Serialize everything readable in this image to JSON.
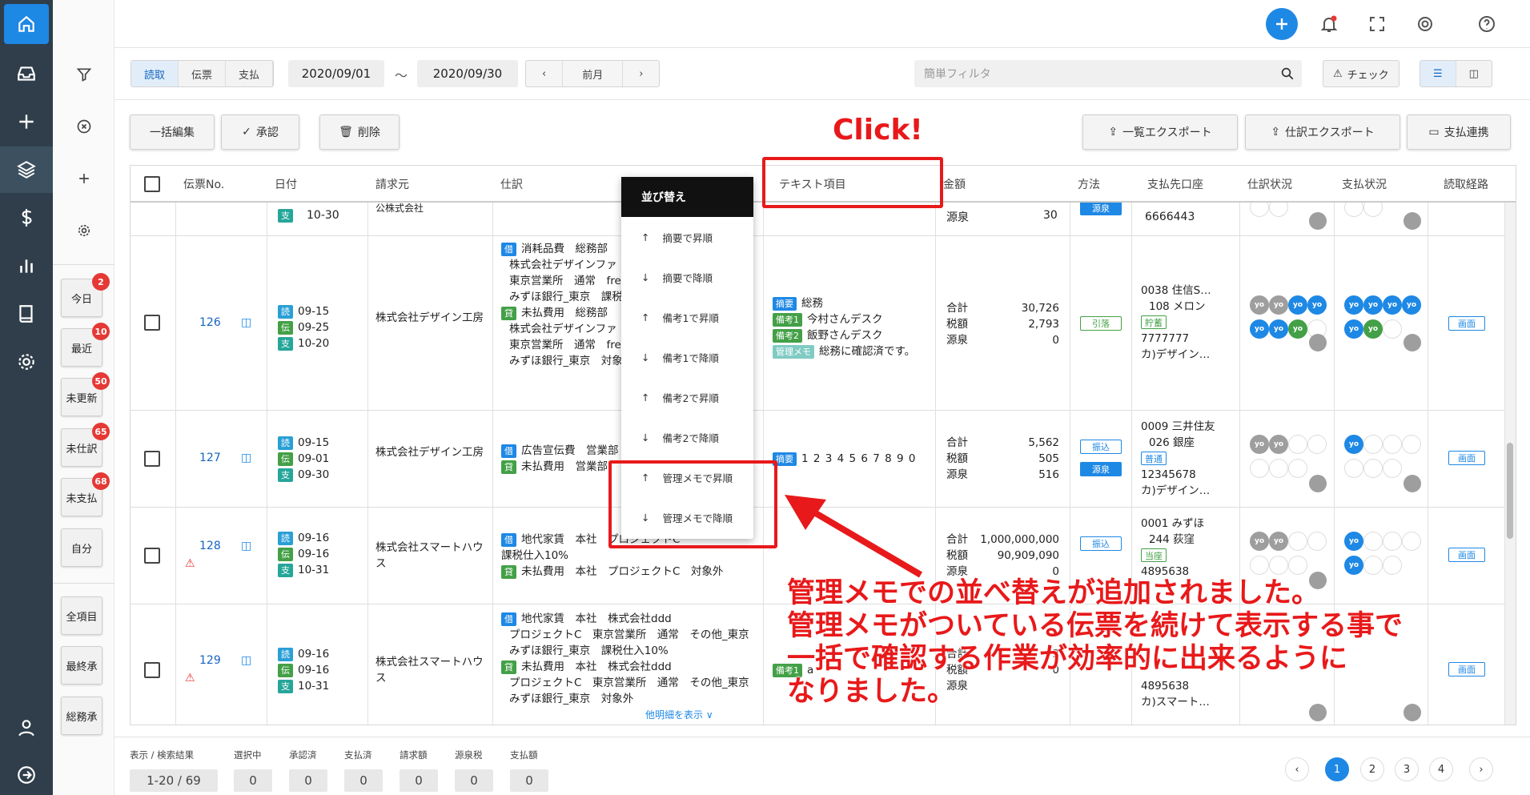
{
  "quick_filters": [
    {
      "label": "今日",
      "count": "2"
    },
    {
      "label": "最近",
      "count": "10"
    },
    {
      "label": "未更新",
      "count": "50"
    },
    {
      "label": "未仕訳",
      "count": "65"
    },
    {
      "label": "未支払",
      "count": "68"
    },
    {
      "label": "自分",
      "count": ""
    },
    {
      "label": "全項目",
      "count": ""
    },
    {
      "label": "最終承",
      "count": ""
    },
    {
      "label": "総務承",
      "count": ""
    }
  ],
  "toolbar": {
    "tabs": [
      "読取",
      "伝票",
      "支払"
    ],
    "date_from": "2020/09/01",
    "tilde": "～",
    "date_to": "2020/09/30",
    "prev_month": "前月",
    "search_placeholder": "簡単フィルタ",
    "check_label": "チェック"
  },
  "actions": {
    "bulk_edit": "一括編集",
    "approve": "承認",
    "delete": "削除",
    "list_export": "一覧エクスポート",
    "journal_export": "仕訳エクスポート",
    "payment_link": "支払連携"
  },
  "columns": [
    "伝票No.",
    "日付",
    "請求元",
    "仕訳",
    "テキスト項目",
    "金額",
    "方法",
    "支払先口座",
    "仕訳状況",
    "支払状況",
    "読取経路"
  ],
  "rows": [
    {
      "no": "",
      "date_tags": [
        "支"
      ],
      "dates": [
        "10-30"
      ],
      "vendor": "公株式会社",
      "journal": [],
      "text": [],
      "amount": {
        "lbl": [
          "源泉"
        ],
        "val": [
          "30"
        ]
      },
      "method": [
        "源泉"
      ],
      "bank": [
        "6666443"
      ]
    },
    {
      "no": "126",
      "dates": [
        "09-15",
        "09-25",
        "10-20"
      ],
      "vendor": "株式会社デザイン工房",
      "journal": [
        "消耗品費　総務部",
        "株式会社デザインファ",
        "東京営業所　通常　free",
        "みずほ銀行_東京　課税",
        "未払費用　総務部",
        "株式会社デザインファ",
        "東京営業所　通常　free",
        "みずほ銀行_東京　対象外"
      ],
      "text_tags": [
        "摘要",
        "備考1",
        "備考2",
        "管理メモ"
      ],
      "text": [
        "総務",
        "今村さんデスク",
        "飯野さんデスク",
        "総務に確認済です。"
      ],
      "amount_lbl": [
        "合計",
        "税額",
        "源泉"
      ],
      "amount_val": [
        "30,726",
        "2,793",
        "0"
      ],
      "method": "引落",
      "bank": [
        "0038 住信S…",
        "108 メロン",
        "貯蓄",
        "7777777",
        "カ)デザイン…"
      ],
      "route": "画面"
    },
    {
      "no": "127",
      "dates": [
        "09-15",
        "09-01",
        "09-30"
      ],
      "vendor": "株式会社デザイン工房",
      "journal": [
        "広告宣伝費　営業部",
        "未払費用　営業部"
      ],
      "text_tag": "摘要",
      "text": "1 2 3 4 5 6 7 8 9 0",
      "amount_lbl": [
        "合計",
        "税額",
        "源泉"
      ],
      "amount_val": [
        "5,562",
        "505",
        "516"
      ],
      "method": [
        "振込",
        "源泉"
      ],
      "bank": [
        "0009 三井住友",
        "026 銀座",
        "普通",
        "12345678",
        "カ)デザイン…"
      ],
      "route": "画面"
    },
    {
      "no": "128",
      "dates": [
        "09-16",
        "09-16",
        "10-31"
      ],
      "vendor": "株式会社スマートハウス",
      "journal": [
        "地代家賃　本社　プロジェクトC",
        "課税仕入10%",
        "未払費用　本社　プロジェクトC　対象外"
      ],
      "amount_lbl": [
        "合計",
        "税額",
        "源泉"
      ],
      "amount_val": [
        "1,000,000,000",
        "90,909,090",
        "0"
      ],
      "method": "振込",
      "bank": [
        "0001 みずほ",
        "244 荻窪",
        "当座",
        "4895638"
      ],
      "route": "画面"
    },
    {
      "no": "129",
      "dates": [
        "09-16",
        "09-16",
        "10-31"
      ],
      "vendor": "株式会社スマートハウス",
      "journal": [
        "地代家賃　本社　株式会社ddd",
        "プロジェクトC　東京営業所　通常　その他_東京",
        "みずほ銀行_東京　課税仕入10%",
        "未払費用　本社　株式会社ddd",
        "プロジェクトC　東京営業所　通常　その他_東京",
        "みずほ銀行_東京　対象外"
      ],
      "more": "他明細を表示 ∨",
      "text_tag": "備考1",
      "text": "a",
      "amount_lbl": [
        "合計",
        "税額",
        "源泉"
      ],
      "amount_val": [
        "3",
        "",
        "0"
      ],
      "bank": [
        "4895638",
        "カ)スマート…"
      ],
      "route": "画面"
    }
  ],
  "date_tags": [
    "読",
    "伝",
    "支"
  ],
  "journal_tags": [
    "借",
    "貸"
  ],
  "circle_label": "yo",
  "sort_menu": {
    "title": "並び替え",
    "items": [
      "摘要で昇順",
      "摘要で降順",
      "備考1で昇順",
      "備考1で降順",
      "備考2で昇順",
      "備考2で降順",
      "管理メモで昇順",
      "管理メモで降順"
    ]
  },
  "annotation": {
    "click": "Click!",
    "lines": [
      "管理メモでの並べ替えが追加されました。",
      "管理メモがついている伝票を続けて表示する事で",
      "一括で確認する作業が効率的に出来るように",
      "なりました。"
    ]
  },
  "footer": {
    "labels": [
      "表示 / 検索結果",
      "選択中",
      "承認済",
      "支払済",
      "請求額",
      "源泉税",
      "支払額"
    ],
    "values": [
      "1-20 / 69",
      "0",
      "0",
      "0",
      "0",
      "0",
      "0"
    ],
    "pages": [
      "1",
      "2",
      "3",
      "4"
    ]
  },
  "colors": {
    "accent": "#1e88e5",
    "annotation_red": "#e8191a",
    "nav_bg": "#2f3e4a"
  }
}
